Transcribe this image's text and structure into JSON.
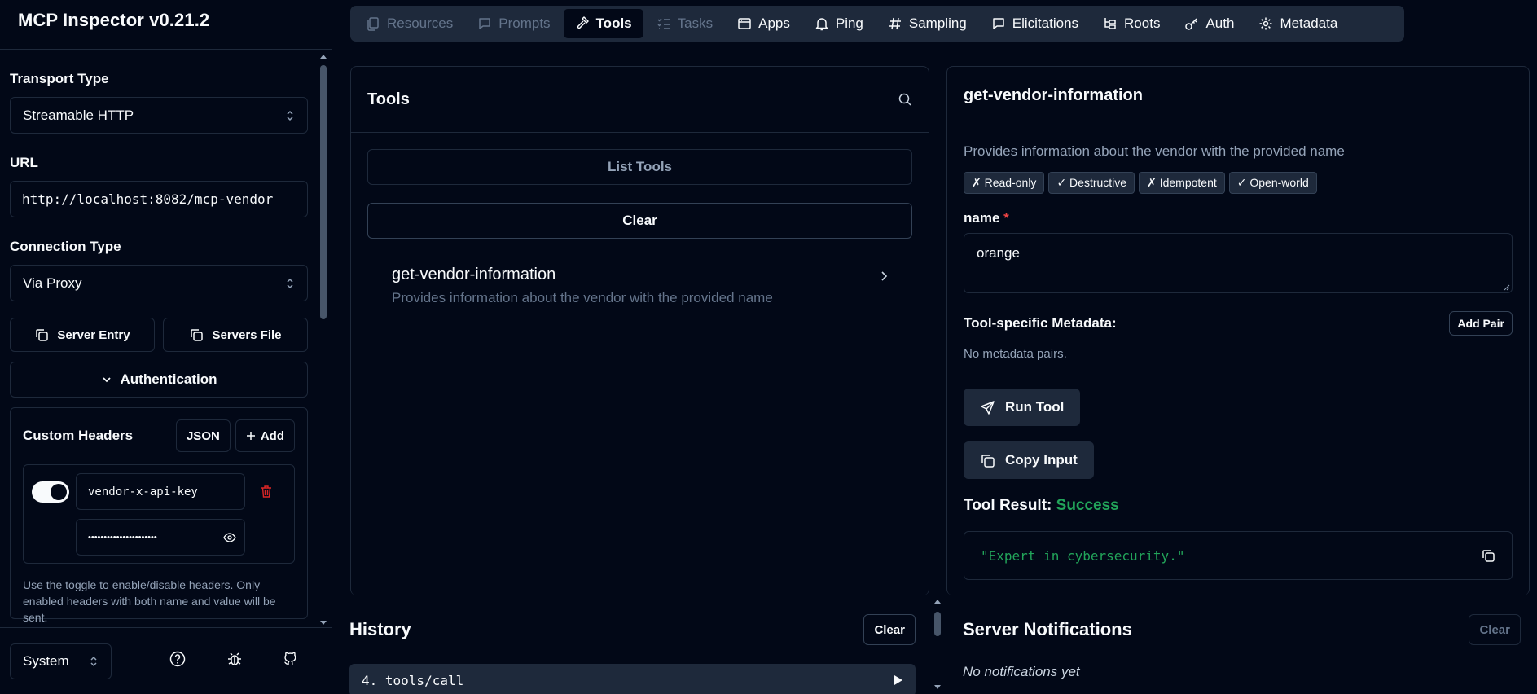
{
  "app": {
    "title": "MCP Inspector v0.21.2"
  },
  "sidebar": {
    "transport_label": "Transport Type",
    "transport_value": "Streamable HTTP",
    "url_label": "URL",
    "url_value": "http://localhost:8082/mcp-vendor",
    "connection_label": "Connection Type",
    "connection_value": "Via Proxy",
    "server_entry_label": "Server Entry",
    "servers_file_label": "Servers File",
    "authentication_label": "Authentication",
    "custom_headers": {
      "title": "Custom Headers",
      "json_label": "JSON",
      "add_label": "Add",
      "header_name": "vendor-x-api-key",
      "header_value_masked": "••••••••••••••••••••••",
      "enabled": true,
      "help": "Use the toggle to enable/disable headers. Only enabled headers with both name and value will be sent."
    },
    "theme_value": "System"
  },
  "tabs": [
    {
      "label": "Resources",
      "icon": "files-icon",
      "state": "disabled"
    },
    {
      "label": "Prompts",
      "icon": "message-icon",
      "state": "disabled"
    },
    {
      "label": "Tools",
      "icon": "hammer-icon",
      "state": "active"
    },
    {
      "label": "Tasks",
      "icon": "list-todo-icon",
      "state": "disabled"
    },
    {
      "label": "Apps",
      "icon": "window-icon",
      "state": "normal"
    },
    {
      "label": "Ping",
      "icon": "bell-icon",
      "state": "normal"
    },
    {
      "label": "Sampling",
      "icon": "hash-icon",
      "state": "normal"
    },
    {
      "label": "Elicitations",
      "icon": "message-square-icon",
      "state": "normal"
    },
    {
      "label": "Roots",
      "icon": "folder-tree-icon",
      "state": "normal"
    },
    {
      "label": "Auth",
      "icon": "key-icon",
      "state": "normal"
    },
    {
      "label": "Metadata",
      "icon": "gear-icon",
      "state": "normal"
    }
  ],
  "tools": {
    "title": "Tools",
    "list_label": "List Tools",
    "clear_label": "Clear",
    "items": [
      {
        "name": "get-vendor-information",
        "description": "Provides information about the vendor with the provided name"
      }
    ]
  },
  "detail": {
    "title": "get-vendor-information",
    "description": "Provides information about the vendor with the provided name",
    "badges": [
      "✗ Read-only",
      "✓ Destructive",
      "✗ Idempotent",
      "✓ Open-world"
    ],
    "param_name": "name",
    "param_required": "*",
    "param_value": "orange",
    "metadata_label": "Tool-specific Metadata:",
    "add_pair_label": "Add Pair",
    "no_metadata": "No metadata pairs.",
    "run_label": "Run Tool",
    "copy_label": "Copy Input",
    "result_label": "Tool Result:",
    "result_status": "Success",
    "result_value": "\"Expert in cybersecurity.\""
  },
  "history": {
    "title": "History",
    "clear_label": "Clear",
    "items": [
      {
        "label": "4. tools/call"
      }
    ]
  },
  "notifications": {
    "title": "Server Notifications",
    "clear_label": "Clear",
    "empty_text": "No notifications yet"
  },
  "colors": {
    "background": "#020817",
    "border": "#1e293b",
    "success": "#22a55a",
    "required": "#ef4444",
    "muted": "#64748b"
  }
}
